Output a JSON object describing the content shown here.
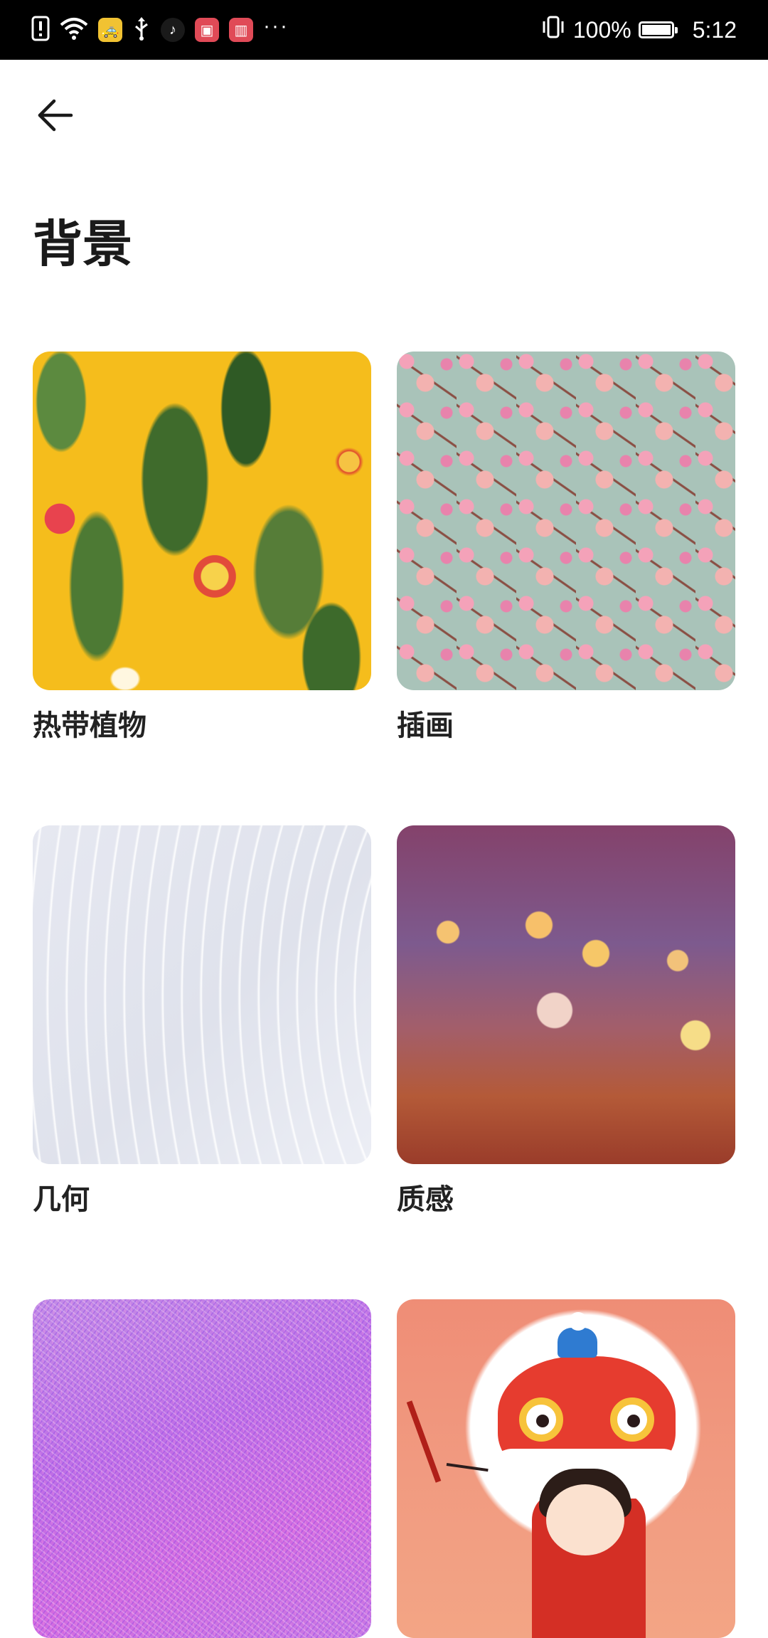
{
  "status_bar": {
    "battery_percent": "100%",
    "time": "5:12",
    "notification_icons": [
      "alert-icon",
      "wifi-icon",
      "taxi-app-icon",
      "usb-icon",
      "tiktok-icon",
      "shopping-bag-icon",
      "book-icon"
    ],
    "more_indicator": "···"
  },
  "header": {
    "back_icon": "arrow-left-icon",
    "title": "背景"
  },
  "categories": [
    {
      "label": "热带植物",
      "accent": "#f5bd1c"
    },
    {
      "label": "插画",
      "accent": "#a9c3b9"
    },
    {
      "label": "几何",
      "accent": "#e3e6ef"
    },
    {
      "label": "质感",
      "accent": "#8b4a6c"
    },
    {
      "label": "",
      "accent": "#c67de6"
    },
    {
      "label": "",
      "accent": "#ef8d76"
    }
  ]
}
